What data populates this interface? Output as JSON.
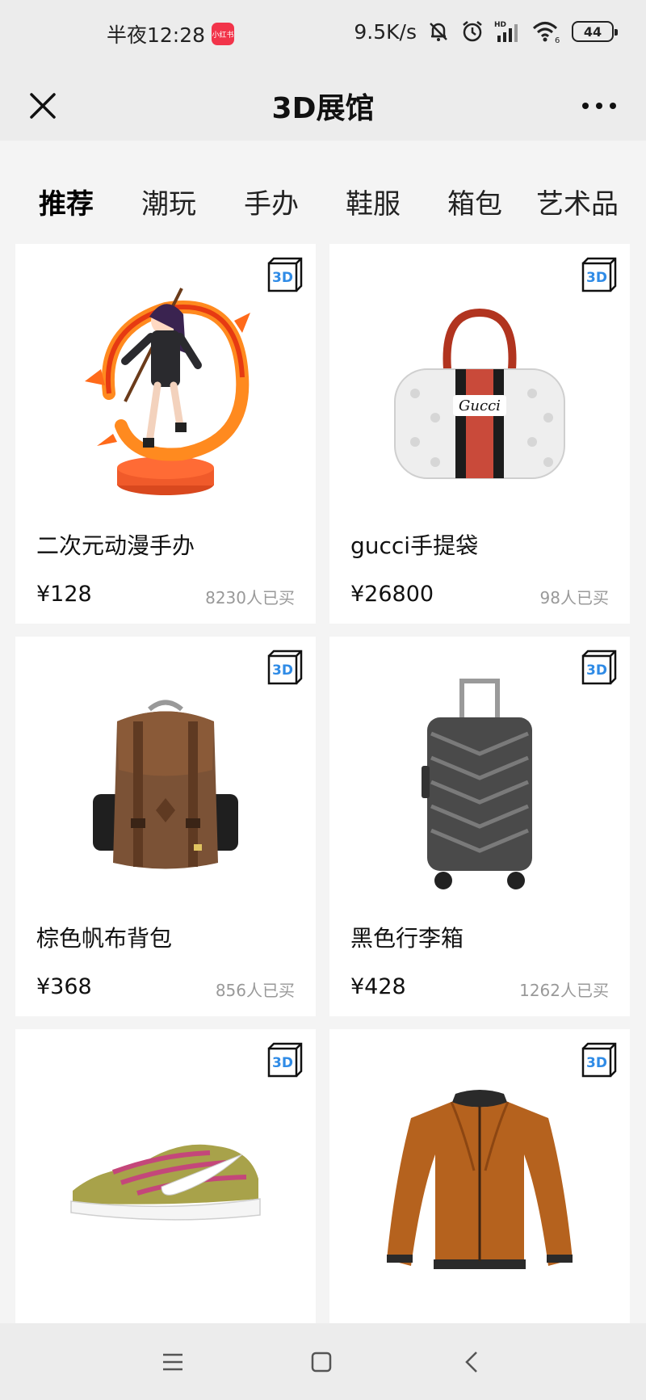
{
  "status_bar": {
    "time": "半夜12:28",
    "app_badge": "小红书",
    "net_speed": "9.5K/s",
    "battery": "44"
  },
  "nav": {
    "title": "3D展馆"
  },
  "tabs": [
    {
      "label": "推荐",
      "active": true
    },
    {
      "label": "潮玩",
      "active": false
    },
    {
      "label": "手办",
      "active": false
    },
    {
      "label": "鞋服",
      "active": false
    },
    {
      "label": "箱包",
      "active": false
    },
    {
      "label": "艺术品",
      "active": false
    }
  ],
  "badge_label": "3D",
  "products": [
    {
      "name": "二次元动漫手办",
      "price": "¥128",
      "sold": "8230人已买",
      "image": "anime-figure"
    },
    {
      "name": "gucci手提袋",
      "price": "¥26800",
      "sold": "98人已买",
      "image": "handbag"
    },
    {
      "name": "棕色帆布背包",
      "price": "¥368",
      "sold": "856人已买",
      "image": "backpack"
    },
    {
      "name": "黑色行李箱",
      "price": "¥428",
      "sold": "1262人已买",
      "image": "suitcase"
    },
    {
      "name": "",
      "price": "",
      "sold": "",
      "image": "sneaker"
    },
    {
      "name": "",
      "price": "",
      "sold": "",
      "image": "leather-jacket"
    }
  ],
  "colors": {
    "accent": "#4aa6f6",
    "background": "#f4f4f4",
    "card": "#ffffff",
    "badge_blue": "#2f8be6"
  }
}
